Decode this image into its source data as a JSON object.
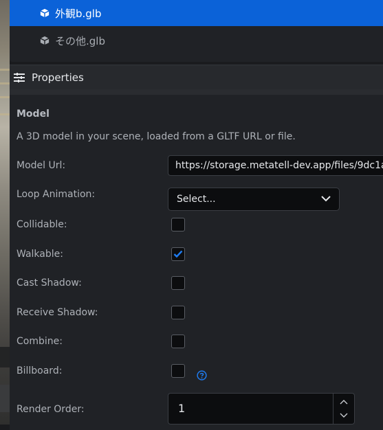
{
  "hierarchy": {
    "items": [
      {
        "label": "外観b.glb",
        "selected": true,
        "icon": "cube-icon"
      },
      {
        "label": "その他.glb",
        "selected": false,
        "icon": "cube-icon"
      }
    ]
  },
  "properties": {
    "header": "Properties",
    "section_title": "Model",
    "description": "A 3D model in your scene, loaded from a GLTF URL or file.",
    "model_url_label": "Model Url:",
    "model_url_value": "https://storage.metatell-dev.app/files/9dc1a",
    "loop_animation_label": "Loop Animation:",
    "loop_animation_value": "Select...",
    "collidable_label": "Collidable:",
    "collidable_checked": false,
    "walkable_label": "Walkable:",
    "walkable_checked": true,
    "cast_shadow_label": "Cast Shadow:",
    "cast_shadow_checked": false,
    "receive_shadow_label": "Receive Shadow:",
    "receive_shadow_checked": false,
    "combine_label": "Combine:",
    "combine_checked": false,
    "billboard_label": "Billboard:",
    "billboard_checked": false,
    "render_order_label": "Render Order:",
    "render_order_value": "1"
  },
  "colors": {
    "accent": "#0b62d8",
    "panel": "#202226",
    "input_bg": "#0c0d0f"
  }
}
